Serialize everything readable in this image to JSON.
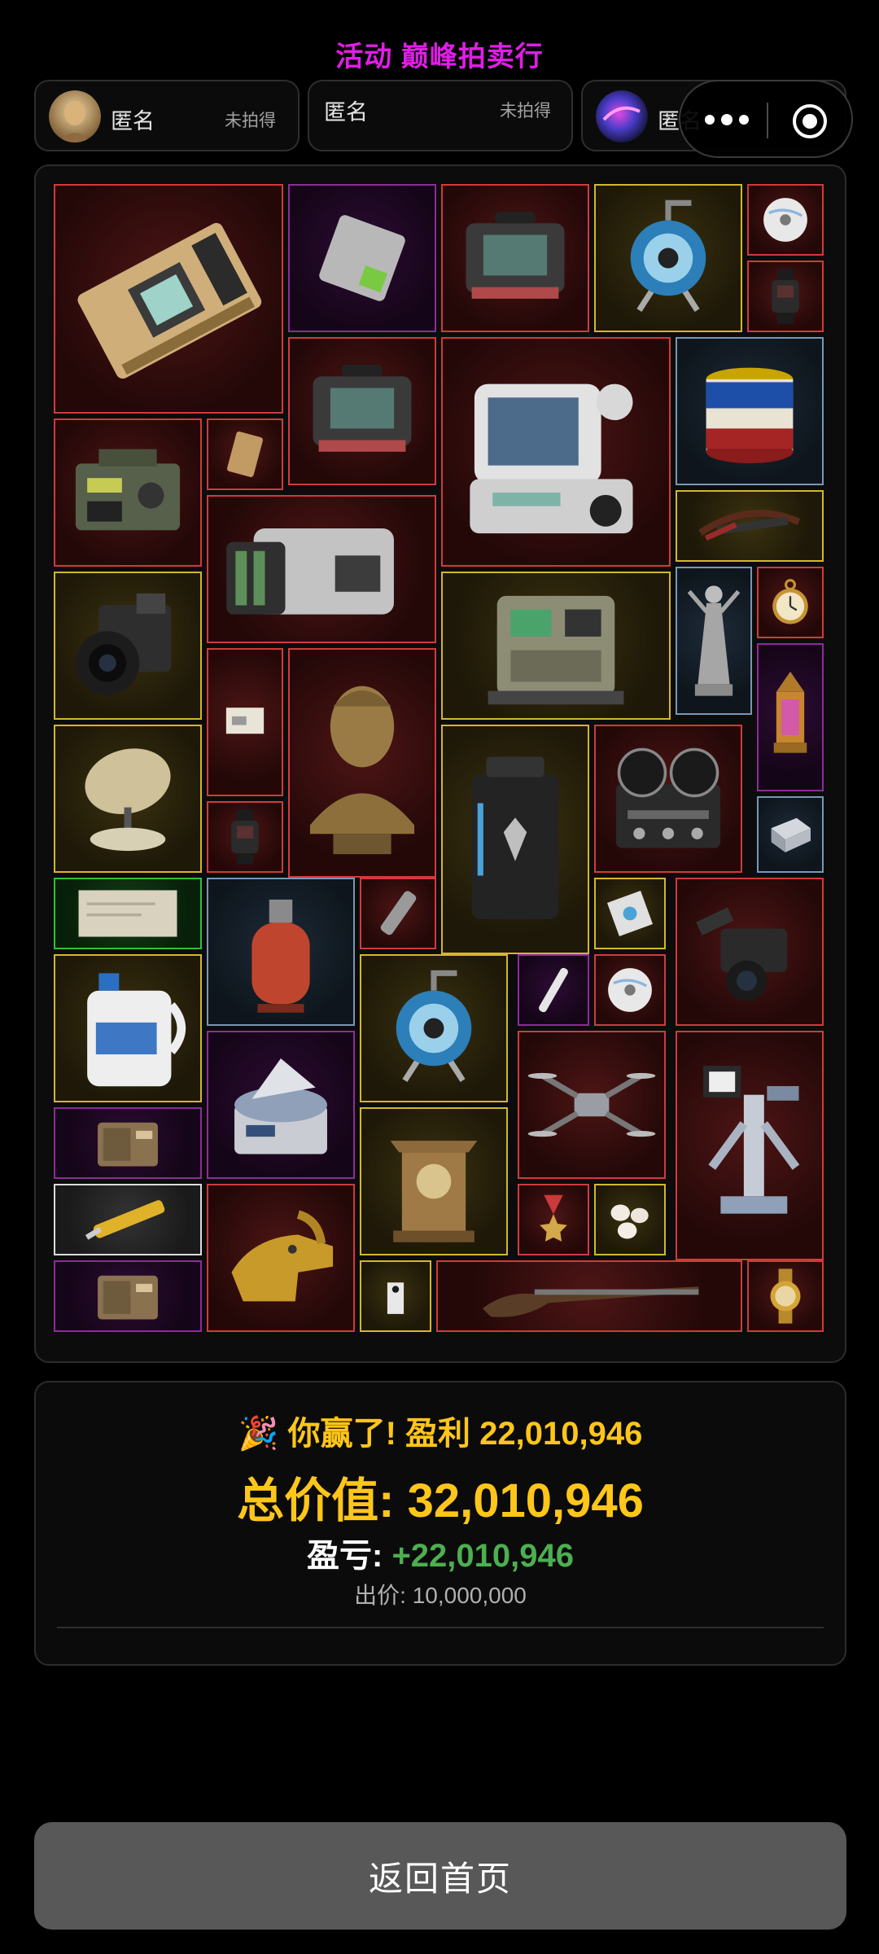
{
  "header": {
    "title": "活动 巅峰拍卖行"
  },
  "players": [
    {
      "name": "匿名",
      "status": "未拍得",
      "avatar": "avatar-sandy"
    },
    {
      "name": "匿名",
      "status": "未拍得",
      "avatar": ""
    },
    {
      "name": "匿名",
      "status": "未拍得",
      "avatar": "avatar-cosmic"
    }
  ],
  "capsule": {
    "menu_icon": "more-dots-icon",
    "close_icon": "target-circle-icon"
  },
  "warehouse": {
    "items": [
      {
        "name": "gpu-card",
        "rarity": "red"
      },
      {
        "name": "ssd-chip",
        "rarity": "purple"
      },
      {
        "name": "monitor-device",
        "rarity": "red"
      },
      {
        "name": "hose-reel",
        "rarity": "gold"
      },
      {
        "name": "cd-disc",
        "rarity": "red"
      },
      {
        "name": "smart-watch",
        "rarity": "red"
      },
      {
        "name": "monitor-device-2",
        "rarity": "red"
      },
      {
        "name": "medical-monitor",
        "rarity": "red"
      },
      {
        "name": "paint-bucket",
        "rarity": "blue"
      },
      {
        "name": "military-radio",
        "rarity": "red"
      },
      {
        "name": "card",
        "rarity": "red"
      },
      {
        "name": "server-rack",
        "rarity": "red"
      },
      {
        "name": "crossbow",
        "rarity": "gold"
      },
      {
        "name": "camera",
        "rarity": "gold"
      },
      {
        "name": "control-console",
        "rarity": "gold"
      },
      {
        "name": "statue-figure",
        "rarity": "blue"
      },
      {
        "name": "pocket-watch",
        "rarity": "red"
      },
      {
        "name": "small-note",
        "rarity": "red"
      },
      {
        "name": "bust-statue",
        "rarity": "red"
      },
      {
        "name": "lantern",
        "rarity": "purple"
      },
      {
        "name": "satellite-dish",
        "rarity": "gold"
      },
      {
        "name": "power-station",
        "rarity": "gold"
      },
      {
        "name": "reel-tape-recorder",
        "rarity": "red"
      },
      {
        "name": "smart-watch-2",
        "rarity": "red"
      },
      {
        "name": "silver-box",
        "rarity": "blue"
      },
      {
        "name": "old-paper",
        "rarity": "green"
      },
      {
        "name": "gas-cylinder",
        "rarity": "blue"
      },
      {
        "name": "flashlight",
        "rarity": "red"
      },
      {
        "name": "cpu-chip",
        "rarity": "gold"
      },
      {
        "name": "video-camera",
        "rarity": "red"
      },
      {
        "name": "detergent-jug",
        "rarity": "gold"
      },
      {
        "name": "hose-reel-2",
        "rarity": "gold"
      },
      {
        "name": "toothbrush",
        "rarity": "purple"
      },
      {
        "name": "cd-disc-2",
        "rarity": "red"
      },
      {
        "name": "centrifuge",
        "rarity": "purple"
      },
      {
        "name": "drone",
        "rarity": "red"
      },
      {
        "name": "medical-robot",
        "rarity": "red"
      },
      {
        "name": "radio",
        "rarity": "purple"
      },
      {
        "name": "ancient-clock",
        "rarity": "gold"
      },
      {
        "name": "medal",
        "rarity": "red"
      },
      {
        "name": "pearls",
        "rarity": "gold"
      },
      {
        "name": "utility-knife",
        "rarity": "white"
      },
      {
        "name": "golden-crocodile-head",
        "rarity": "red"
      },
      {
        "name": "radio-2",
        "rarity": "purple"
      },
      {
        "name": "tag",
        "rarity": "gold"
      },
      {
        "name": "flintlock-rifle",
        "rarity": "red"
      },
      {
        "name": "gold-watch",
        "rarity": "red"
      }
    ]
  },
  "result": {
    "party_icon": "🎉",
    "win_text": "你赢了! 盈利 22,010,946",
    "total_label": "总价值:",
    "total_value": "32,010,946",
    "pl_label": "盈亏:",
    "pl_value": "+22,010,946",
    "bid_text": "出价: 10,000,000"
  },
  "footer": {
    "home_button": "返回首页"
  }
}
